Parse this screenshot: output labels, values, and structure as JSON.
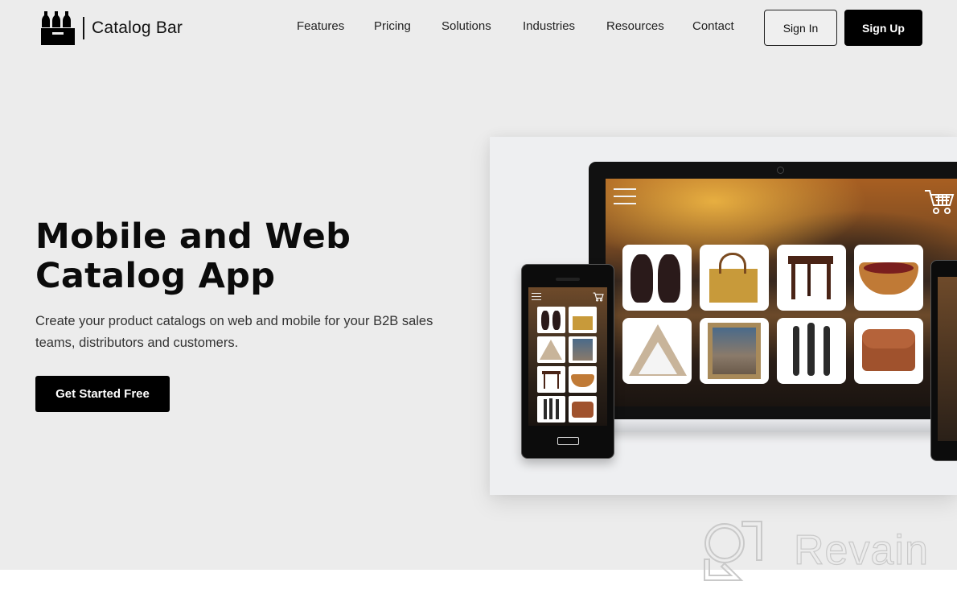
{
  "brand": {
    "name": "Catalog Bar",
    "logo_icon": "bottle-crate-icon"
  },
  "nav": {
    "items": [
      {
        "label": "Features"
      },
      {
        "label": "Pricing"
      },
      {
        "label": "Solutions"
      },
      {
        "label": "Industries"
      },
      {
        "label": "Resources"
      },
      {
        "label": "Contact"
      }
    ],
    "sign_in_label": "Sign In",
    "sign_up_label": "Sign Up"
  },
  "hero": {
    "title": "Mobile and Web Catalog App",
    "subtitle": "Create your product catalogs on web and mobile for your B2B sales teams, distributors and customers.",
    "cta_label": "Get Started Free"
  },
  "mockup": {
    "menu_icon": "hamburger-menu-icon",
    "cart_icon": "shopping-cart-icon",
    "products": [
      {
        "name": "vases"
      },
      {
        "name": "woven-bag"
      },
      {
        "name": "wooden-stool"
      },
      {
        "name": "basket"
      },
      {
        "name": "triangle-shelf"
      },
      {
        "name": "framed-painting"
      },
      {
        "name": "figurines"
      },
      {
        "name": "leather-bag"
      }
    ]
  },
  "watermark": {
    "text": "Revain"
  },
  "colors": {
    "hero_bg": "#ececec",
    "primary": "#000000",
    "text": "#111111"
  }
}
